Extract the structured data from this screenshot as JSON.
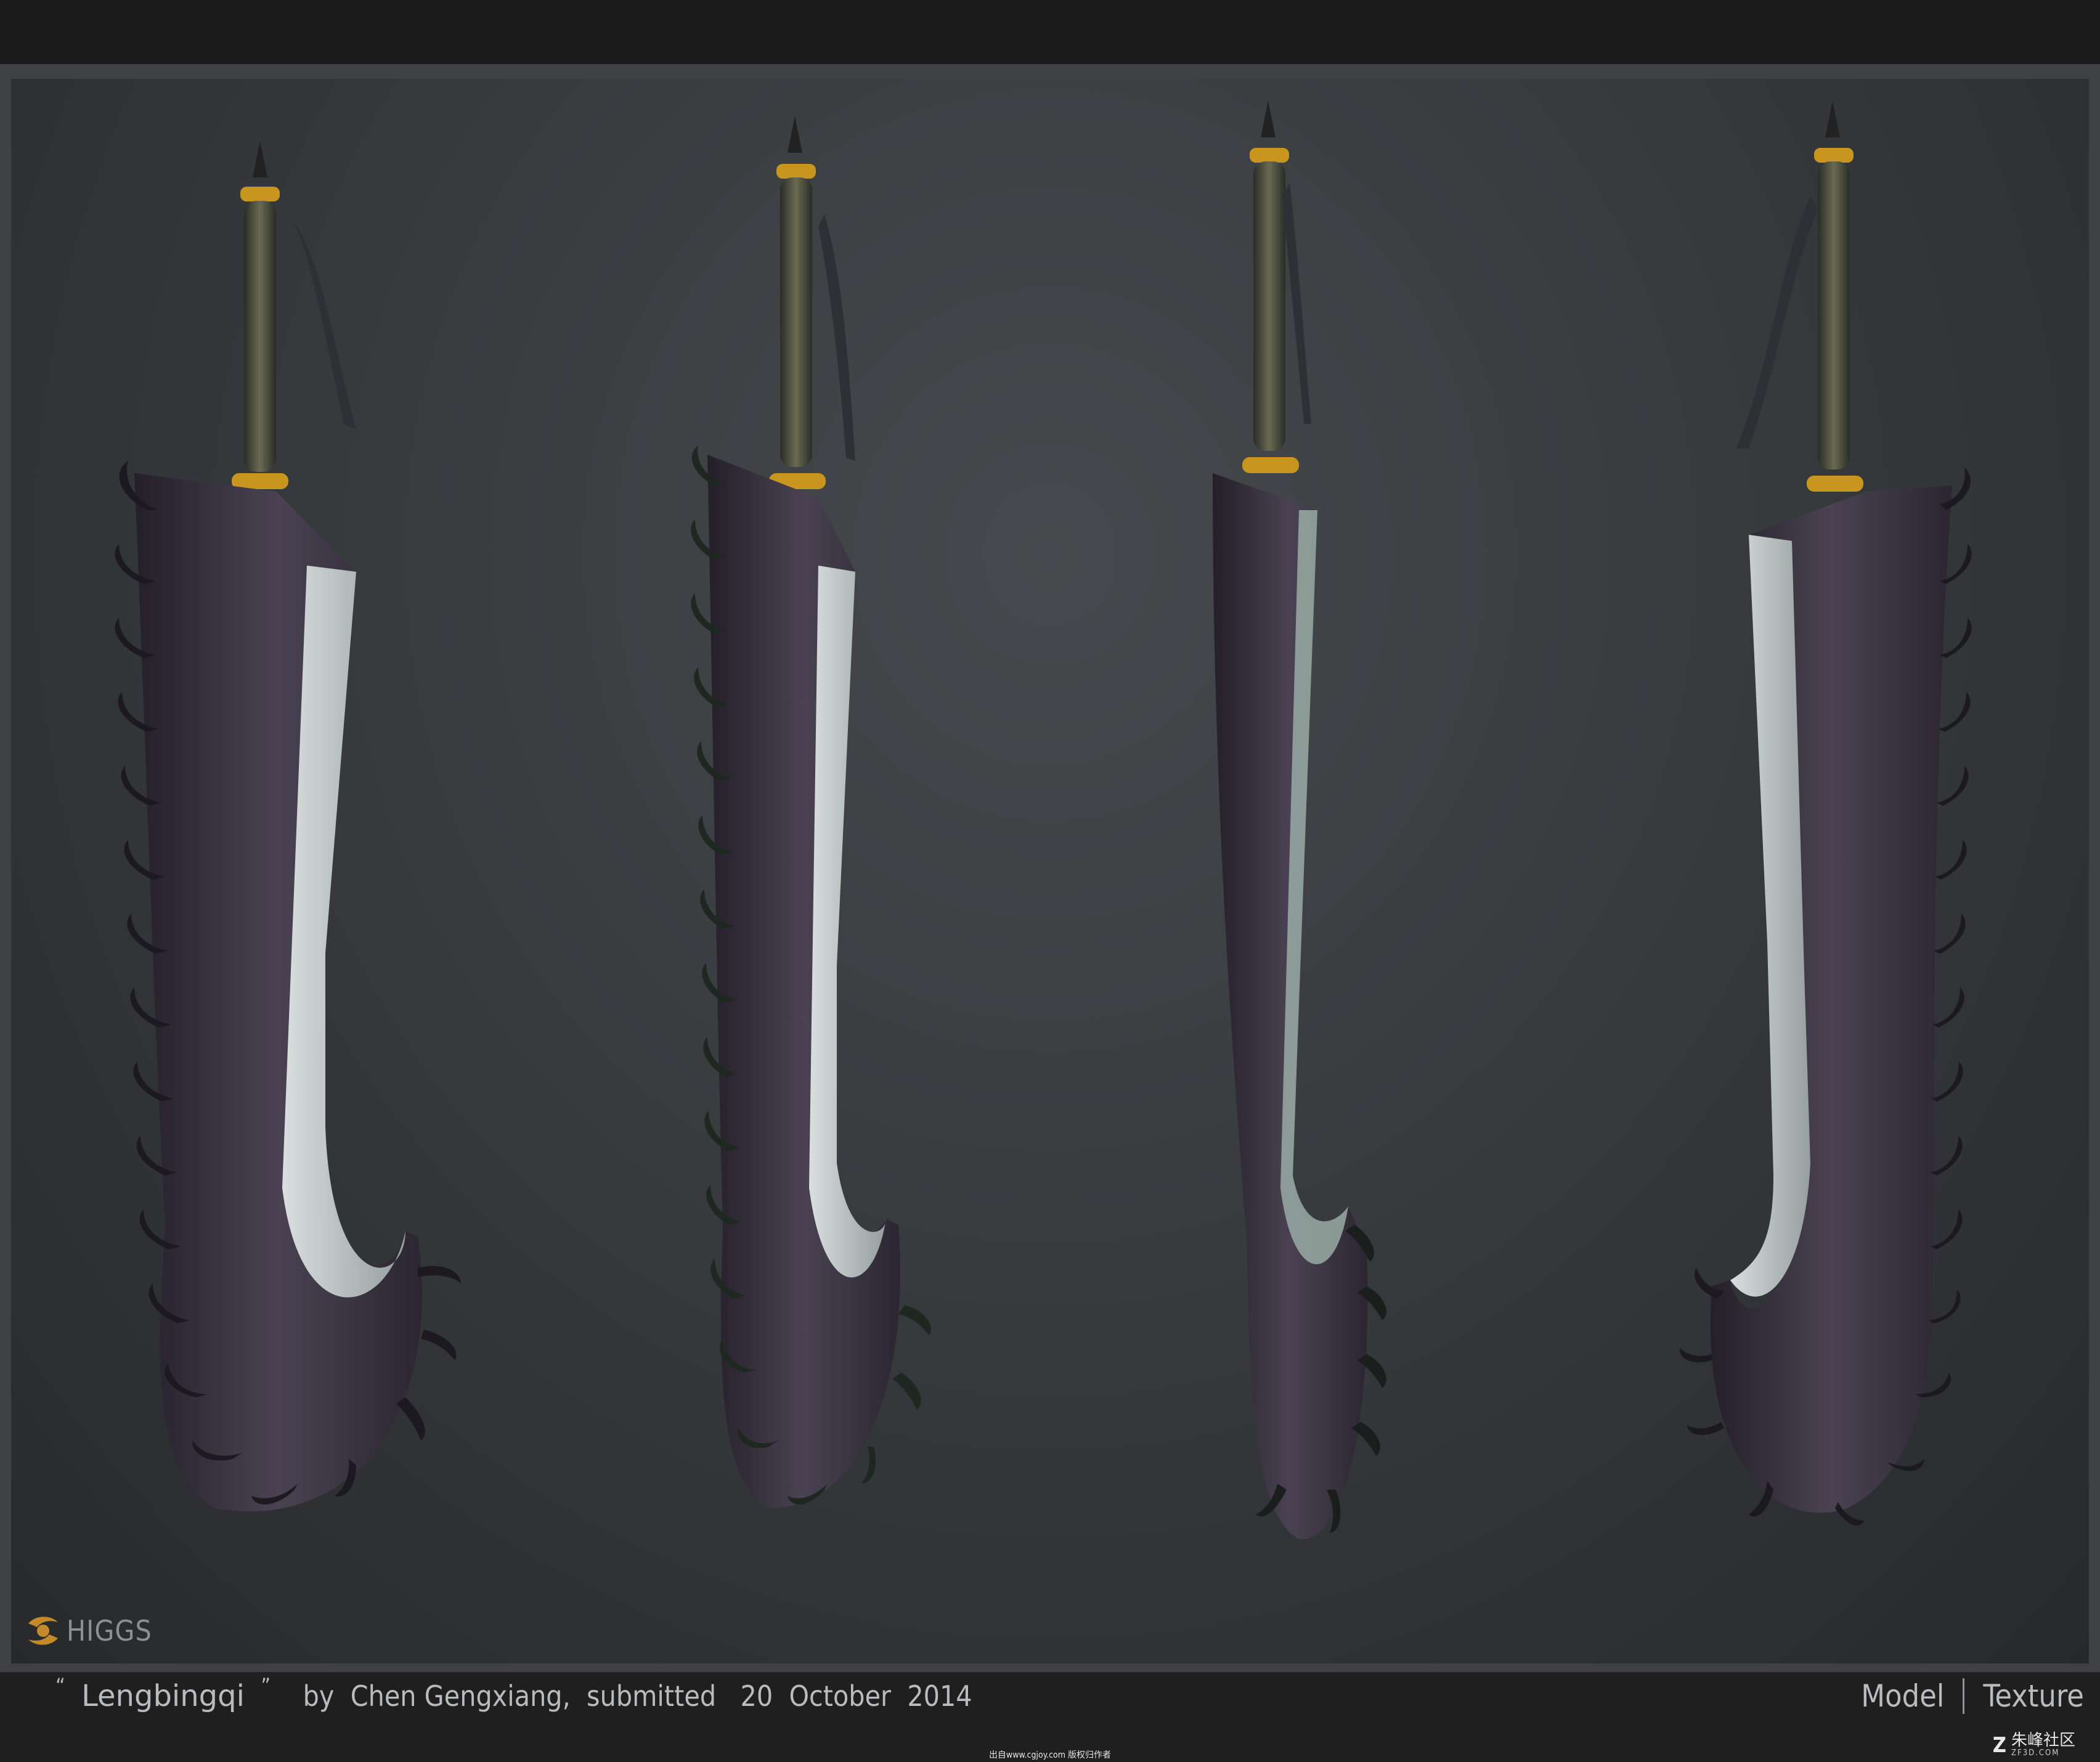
{
  "caption": {
    "open_quote": "“",
    "title": "Lengbingqi",
    "close_quote": "”",
    "by": "by",
    "author": "Chen Gengxiang,",
    "submitted": "submitted",
    "date": "20  October  2014"
  },
  "nav": {
    "model_label": "Model",
    "texture_label": "Texture"
  },
  "logo": {
    "text": "HIGGS"
  },
  "credit": {
    "text": "出自www.cgjoy.com 版权归作者"
  },
  "watermark": {
    "mark": "Z",
    "text": "朱峰社区",
    "sub": "ZF3D.COM"
  },
  "colors": {
    "blade_edge": "#c9d2d0",
    "blade_body": "#3a3340",
    "handle_gold": "#c8961e",
    "background": "#3a3d40",
    "bar": "#1f1f20"
  }
}
